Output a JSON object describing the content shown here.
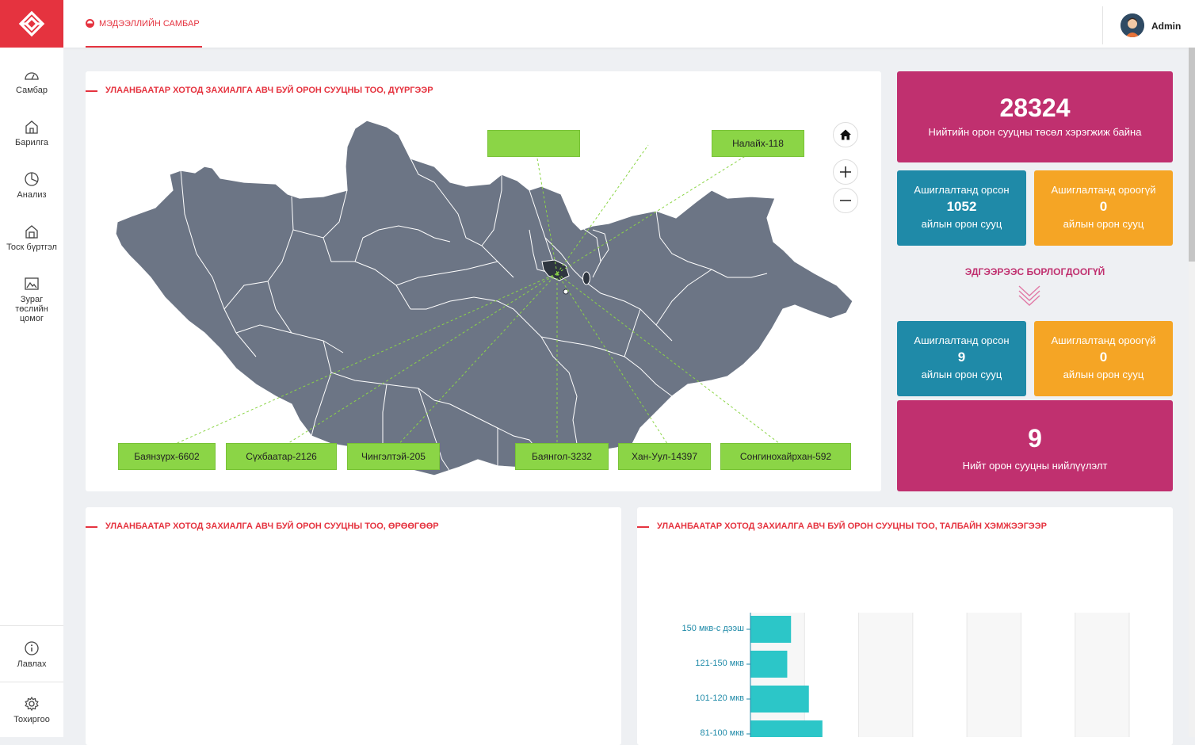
{
  "app": {
    "user_name": "Admin"
  },
  "topbar": {
    "active_tab": "МЭДЭЭЛЛИЙН САМБАР"
  },
  "sidebar": {
    "items": [
      {
        "label": "Самбар",
        "icon": "dashboard-icon"
      },
      {
        "label": "Барилга",
        "icon": "home-icon"
      },
      {
        "label": "Анализ",
        "icon": "pie-chart-icon"
      },
      {
        "label": "Тоск бүртгэл",
        "icon": "building-icon"
      },
      {
        "label": "Зураг төслийн цомог",
        "icon": "gallery-icon"
      }
    ],
    "bottom_items": [
      {
        "label": "Лавлах",
        "icon": "info-icon"
      },
      {
        "label": "Тохиргоо",
        "icon": "gear-icon"
      }
    ]
  },
  "map_card": {
    "title": "УЛААНБААТАР ХОТОД ЗАХИАЛГА АВЧ БУЙ ОРОН СУУЦНЫ ТОО, ДҮҮРГЭЭР",
    "labels": [
      {
        "text": ""
      },
      {
        "text": "Налайх-118"
      },
      {
        "text": "Баянзүрх-6602"
      },
      {
        "text": "Сүхбаатар-2126"
      },
      {
        "text": "Чингэлтэй-205"
      },
      {
        "text": "Баянгол-3232"
      },
      {
        "text": "Хан-Уул-14397"
      },
      {
        "text": "Сонгинохайрхан-592"
      }
    ],
    "map_color": "#6c7585",
    "label_color": "#8bd546"
  },
  "stats": {
    "total": {
      "value": "28324",
      "caption": "Нийтийн орон сууцны төсөл хэрэгжиж байна"
    },
    "top_left": {
      "title": "Ашиглалтанд орсон",
      "value": "1052",
      "caption": "айлын орон сууц"
    },
    "top_right": {
      "title": "Ашиглалтанд ороогүй",
      "value": "0",
      "caption": "айлын орон сууц"
    },
    "between": "ЭДГЭЭРЭЭС БОРЛОГДООГҮЙ",
    "bottom_left": {
      "title": "Ашиглалтанд орсон",
      "value": "9",
      "caption": "айлын орон сууц"
    },
    "bottom_right": {
      "title": "Ашиглалтанд ороогүй",
      "value": "0",
      "caption": "айлын орон сууц"
    },
    "supply": {
      "value": "9",
      "caption": "Нийт орон сууцны нийлүүлэлт"
    }
  },
  "room_card": {
    "title": "УЛААНБААТАР ХОТОД ЗАХИАЛГА АВЧ БУЙ ОРОН СУУЦНЫ ТОО, ӨРӨӨГӨӨР"
  },
  "area_card": {
    "title": "УЛААНБААТАР ХОТОД ЗАХИАЛГА АВЧ БУЙ ОРОН СУУЦНЫ ТОО, ТАЛБАЙН ХЭМЖЭЭГЭЭР"
  },
  "chart_data": {
    "type": "bar",
    "orientation": "horizontal",
    "categories": [
      "150 мкв-с дээш",
      "121-150 мкв",
      "101-120 мкв",
      "81-100 мкв"
    ],
    "values": [
      0.75,
      0.68,
      1.08,
      1.33
    ],
    "xlim": [
      0,
      7
    ],
    "bar_color": "#2cc6c8",
    "grid": true
  }
}
